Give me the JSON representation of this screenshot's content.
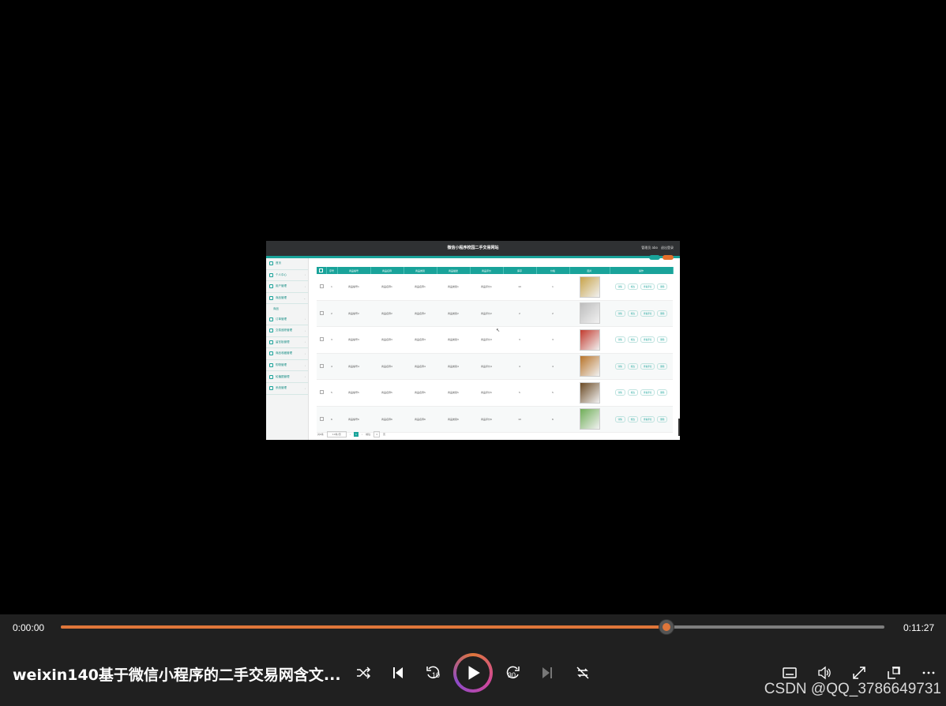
{
  "app": {
    "title": "微信小程序校园二手交易网站",
    "user": "管理员 abo",
    "logout": "退出登录"
  },
  "sidebar": {
    "items": [
      {
        "label": "首页"
      },
      {
        "label": "个人中心"
      },
      {
        "label": "用户管理"
      },
      {
        "label": "商品管理"
      },
      {
        "label": "订单管理"
      },
      {
        "label": "交易追踪管理"
      },
      {
        "label": "留言板管理"
      },
      {
        "label": "商品收藏管理"
      },
      {
        "label": "购物管理"
      },
      {
        "label": "轮播图管理"
      },
      {
        "label": "系统管理"
      }
    ],
    "sub_label": "商品"
  },
  "table": {
    "headers": [
      "",
      "序号",
      "商品编号",
      "商品名称",
      "商品类别",
      "商品描述",
      "商品评价",
      "库存",
      "价格",
      "图片",
      "操作"
    ],
    "rows": [
      {
        "idx": "1",
        "c1": "商品编号1",
        "c2": "商品名称1",
        "c3": "商品名称1",
        "c4": "商品类别1",
        "c5": "商品评价1",
        "stock": "10",
        "price": "1",
        "img_color": "#c8a44a"
      },
      {
        "idx": "2",
        "c1": "商品编号2",
        "c2": "商品名称2",
        "c3": "商品名称2",
        "c4": "商品类别2",
        "c5": "商品评价2",
        "stock": "2",
        "price": "2",
        "img_color": "#bdbdbd"
      },
      {
        "idx": "3",
        "c1": "商品编号3",
        "c2": "商品名称3",
        "c3": "商品名称3",
        "c4": "商品类别3",
        "c5": "商品评价3",
        "stock": "3",
        "price": "3",
        "img_color": "#c23b2e"
      },
      {
        "idx": "4",
        "c1": "商品编号4",
        "c2": "商品名称4",
        "c3": "商品名称4",
        "c4": "商品类别4",
        "c5": "商品评价4",
        "stock": "4",
        "price": "4",
        "img_color": "#b8742a"
      },
      {
        "idx": "5",
        "c1": "商品编号5",
        "c2": "商品名称5",
        "c3": "商品名称5",
        "c4": "商品类别5",
        "c5": "商品评价5",
        "stock": "5",
        "price": "5",
        "img_color": "#6b4a24"
      },
      {
        "idx": "6",
        "c1": "商品编号6",
        "c2": "商品名称6",
        "c3": "商品名称6",
        "c4": "商品类别6",
        "c5": "商品评价6",
        "stock": "10",
        "price": "6",
        "img_color": "#6fae57"
      }
    ],
    "ops": [
      "详情",
      "修改",
      "查看评论",
      "删除"
    ]
  },
  "pager": {
    "total": "共6条",
    "per_page": "10条/页",
    "current": "1",
    "goto": "前往",
    "page_input": "1",
    "page_unit": "页"
  },
  "player": {
    "current_time": "0:00:00",
    "total_time": "0:11:27",
    "progress_fraction": 0.735,
    "title": "weixin140基于微信小程序的二手交易网含文...",
    "skip_back": "10",
    "skip_forward": "30",
    "watermark": "CSDN @QQ_3786649731",
    "accent": "#e0763a"
  }
}
